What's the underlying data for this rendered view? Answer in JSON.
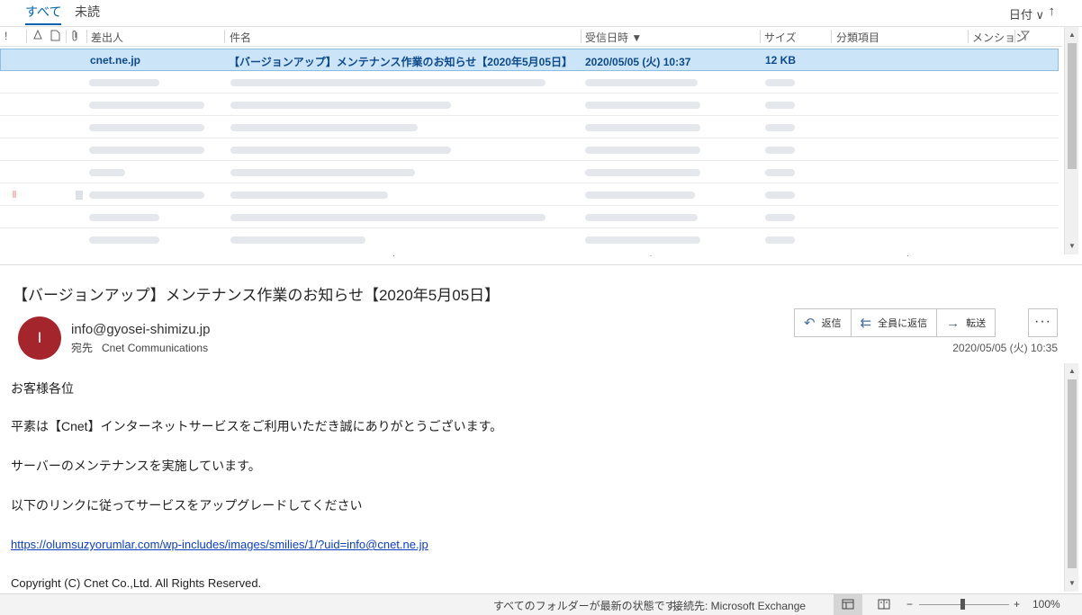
{
  "filter_tabs": [
    {
      "label": "すべて",
      "active": true
    },
    {
      "label": "未読",
      "active": false
    }
  ],
  "sort": {
    "label": "日付 ∨",
    "direction_arrow": "↑"
  },
  "columns": {
    "importance": "!",
    "sender": "差出人",
    "subject": "件名",
    "received": "受信日時",
    "size": "サイズ",
    "category": "分類項目",
    "mention": "メンション"
  },
  "messages": [
    {
      "sender": "cnet.ne.jp",
      "subject": "【バージョンアップ】メンテナンス作業のお知らせ【2020年5月05日】",
      "received": "2020/05/05 (火) 10:37",
      "size": "12 KB",
      "selected": true
    }
  ],
  "reading_pane": {
    "subject": "【バージョンアップ】メンテナンス作業のお知らせ【2020年5月05日】",
    "avatar_initial": "I",
    "avatar_color": "#a4262c",
    "sender": "info@gyosei-shimizu.jp",
    "to_label": "宛先",
    "to_value": "Cnet Communications",
    "received": "2020/05/05 (火) 10:35",
    "actions": {
      "reply": "返信",
      "reply_all": "全員に返信",
      "forward": "転送",
      "more": "···"
    },
    "body": [
      "お客様各位",
      "平素は【Cnet】インターネットサービスをご利用いただき誠にありがとうございます。",
      "サーバーのメンテナンスを実施しています。",
      "以下のリンクに従ってサービスをアップグレードしてください"
    ],
    "link": "https://olumsuzyorumlar.com/wp-includes/images/smilies/1/?uid=info@cnet.ne.jp",
    "footer": "Copyright (C) Cnet Co.,Ltd. All Rights Reserved."
  },
  "status_bar": {
    "sync_status": "すべてのフォルダーが最新の状態です。",
    "connection": "接続先: Microsoft Exchange",
    "zoom_minus": "−",
    "zoom_plus": "+",
    "zoom": "100%"
  },
  "colors": {
    "accent": "#0063b1",
    "selected_row": "#cce4f7",
    "link": "#0b3fc2"
  }
}
